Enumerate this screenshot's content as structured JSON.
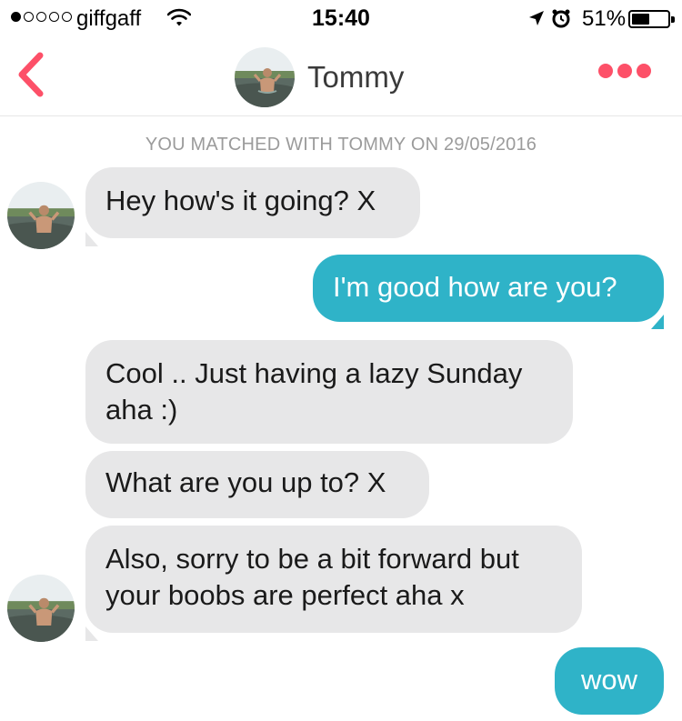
{
  "status_bar": {
    "signal_filled": 1,
    "signal_total": 5,
    "carrier": "giffgaff",
    "time": "15:40",
    "battery": "51%",
    "battery_level": 0.51
  },
  "header": {
    "name": "Tommy",
    "accent_color": "#fd5068"
  },
  "match_banner": "YOU MATCHED WITH TOMMY ON 29/05/2016",
  "messages": [
    {
      "from": "them",
      "text": "Hey how's it going? X"
    },
    {
      "from": "me",
      "text": "I'm good how are you?"
    },
    {
      "from": "them",
      "lines": [
        "Cool .. Just having a lazy Sunday",
        "aha :)"
      ]
    },
    {
      "from": "them",
      "text": "What are you up to? X"
    },
    {
      "from": "them",
      "lines": [
        "Also, sorry to be a bit forward but",
        "your boobs are perfect aha x"
      ]
    },
    {
      "from": "me",
      "text": "wow"
    }
  ],
  "colors": {
    "incoming_bubble": "#e7e7e8",
    "outgoing_bubble": "#2fb3c8",
    "back_arrow": "#fd5068"
  }
}
